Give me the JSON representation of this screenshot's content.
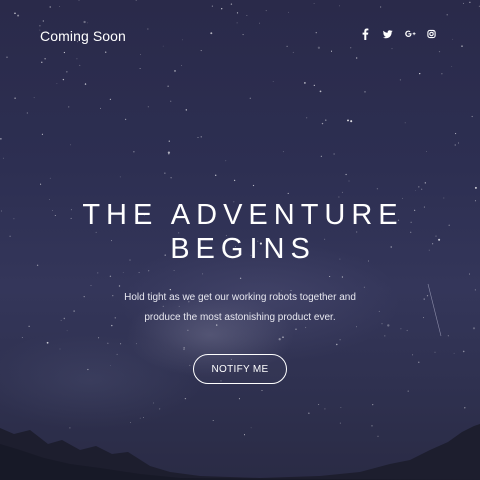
{
  "brand": {
    "title": "Coming Soon"
  },
  "social": [
    {
      "name": "facebook",
      "glyph": "f"
    },
    {
      "name": "twitter",
      "glyph": "t"
    },
    {
      "name": "google-plus",
      "glyph": "G+"
    },
    {
      "name": "instagram",
      "glyph": "ig"
    }
  ],
  "hero": {
    "headline": "THE ADVENTURE BEGINS",
    "tagline_line1": "Hold tight as we get our working robots together and",
    "tagline_line2": "produce the most astonishing product ever."
  },
  "cta": {
    "label": "NOTIFY ME"
  },
  "colors": {
    "sky_top": "#2a2a4a",
    "sky_mid": "#34365a",
    "text": "#ffffff"
  }
}
